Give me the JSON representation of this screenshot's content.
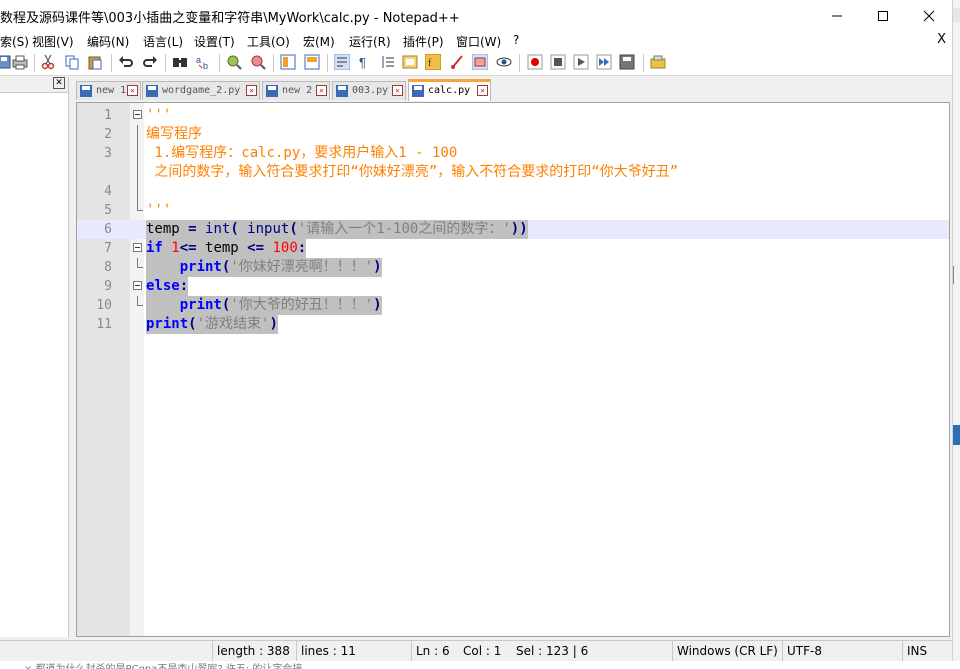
{
  "window": {
    "title": "数程及源码课件等\\003小插曲之变量和字符串\\MyWork\\calc.py - Notepad++",
    "minimize_label": "—",
    "maximize_label": "☐",
    "close_label": "✕"
  },
  "menu": {
    "items": [
      "索(S)",
      "视图(V)",
      "编码(N)",
      "语言(L)",
      "设置(T)",
      "工具(O)",
      "宏(M)",
      "运行(R)",
      "插件(P)",
      "窗口(W)",
      "?"
    ],
    "close_doc": "X"
  },
  "panel": {
    "close_label": "✕"
  },
  "tabs": [
    {
      "label": "new 1",
      "active": false
    },
    {
      "label": "wordgame_2.py",
      "active": false
    },
    {
      "label": "new 2",
      "active": false
    },
    {
      "label": "003.py",
      "active": false
    },
    {
      "label": "calc.py",
      "active": true
    }
  ],
  "editor": {
    "line_numbers": [
      "1",
      "2",
      "3",
      "",
      "4",
      "5",
      "6",
      "7",
      "8",
      "9",
      "10",
      "11"
    ],
    "lines": [
      {
        "parts": [
          {
            "t": "'''",
            "c": "doc"
          }
        ]
      },
      {
        "parts": [
          {
            "t": "编写程序",
            "c": "doc"
          }
        ]
      },
      {
        "parts": [
          {
            "t": " 1.编写程序：calc.py，要求用户输入1 - 100",
            "c": "doc"
          }
        ]
      },
      {
        "parts": [
          {
            "t": " 之间的数字，输入符合要求打印“你妹好漂亮”，输入不符合要求的打印“你大爷好丑”",
            "c": "doc"
          }
        ]
      },
      {
        "parts": [
          {
            "t": "",
            "c": "doc"
          }
        ]
      },
      {
        "parts": [
          {
            "t": "'''",
            "c": "doc"
          }
        ]
      },
      {
        "parts": [
          {
            "t": "temp",
            "c": "id"
          },
          {
            "t": " = ",
            "c": "op"
          },
          {
            "t": "int",
            "c": "bi"
          },
          {
            "t": "( ",
            "c": "op"
          },
          {
            "t": "input",
            "c": "bi"
          },
          {
            "t": "(",
            "c": "op"
          },
          {
            "t": "'请输入一个1-100之间的数字：'",
            "c": "str"
          },
          {
            "t": "))",
            "c": "op"
          }
        ]
      },
      {
        "parts": [
          {
            "t": "if",
            "c": "kw"
          },
          {
            "t": " ",
            "c": "id"
          },
          {
            "t": "1",
            "c": "num"
          },
          {
            "t": "<=",
            "c": "op"
          },
          {
            "t": " temp ",
            "c": "id"
          },
          {
            "t": "<=",
            "c": "op"
          },
          {
            "t": " ",
            "c": "id"
          },
          {
            "t": "100",
            "c": "num"
          },
          {
            "t": ":",
            "c": "op"
          }
        ]
      },
      {
        "parts": [
          {
            "t": "    ",
            "c": "id"
          },
          {
            "t": "print",
            "c": "kw"
          },
          {
            "t": "(",
            "c": "op"
          },
          {
            "t": "'你妹好漂亮啊！！！'",
            "c": "str"
          },
          {
            "t": ")",
            "c": "op"
          }
        ]
      },
      {
        "parts": [
          {
            "t": "else",
            "c": "kw"
          },
          {
            "t": ":",
            "c": "op"
          }
        ]
      },
      {
        "parts": [
          {
            "t": "    ",
            "c": "id"
          },
          {
            "t": "print",
            "c": "kw"
          },
          {
            "t": "(",
            "c": "op"
          },
          {
            "t": "'你大爷的好丑！！！'",
            "c": "str"
          },
          {
            "t": ")",
            "c": "op"
          }
        ]
      },
      {
        "parts": [
          {
            "t": "print",
            "c": "kw"
          },
          {
            "t": "(",
            "c": "op"
          },
          {
            "t": "'游戏结束'",
            "c": "str"
          },
          {
            "t": ")",
            "c": "op"
          }
        ]
      }
    ]
  },
  "status": {
    "length": "length : 388",
    "lines": "lines : 11",
    "ln": "Ln : 6",
    "col": "Col : 1",
    "sel": "Sel : 123 | 6",
    "eol": "Windows (CR LF)",
    "encoding": "UTF-8",
    "mode": "INS"
  },
  "taskbar_snippet": "× 都道为什么封杀的是PCgpa不是杏山翠呢?  许五: 的让字会接",
  "colors": {
    "doc_string": "#ff8000",
    "keyword": "#0000ff",
    "string": "#808080",
    "number": "#ff0000",
    "selection": "#c0c0c0",
    "active_tab_accent": "#f9a43a"
  },
  "toolbar_icons": [
    "new-file-icon",
    "open-file-icon",
    "save-icon",
    "save-all-icon",
    "close-icon",
    "close-all-icon",
    "print-icon",
    "cut-icon",
    "copy-icon",
    "paste-icon",
    "undo-icon",
    "redo-icon",
    "find-icon",
    "replace-icon",
    "zoom-in-icon",
    "zoom-out-icon",
    "sync-vertical-icon",
    "sync-horizontal-icon",
    "word-wrap-icon",
    "show-all-chars-icon",
    "indent-guide-icon",
    "doc-map-icon",
    "function-list-icon",
    "folder-workspace-icon",
    "monitoring-icon",
    "record-macro-icon",
    "stop-record-icon",
    "play-macro-icon",
    "run-macro-multiple-icon",
    "save-macro-icon",
    "plugin-icon"
  ]
}
